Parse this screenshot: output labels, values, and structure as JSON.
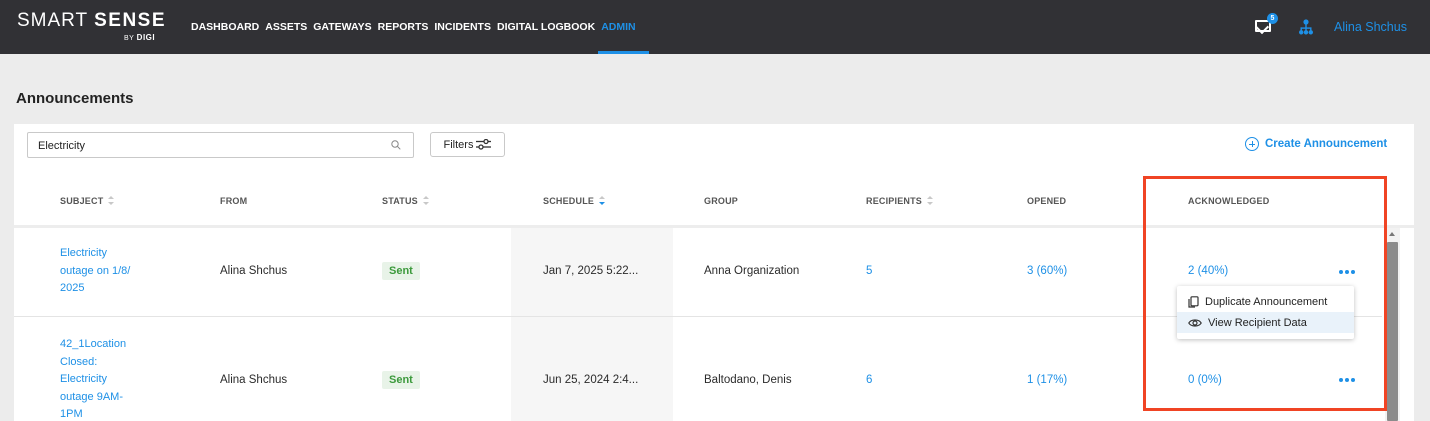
{
  "brand": {
    "name_light": "SMART",
    "name_bold": "SENSE",
    "sub_by": "BY",
    "sub_brand": "DIGI"
  },
  "nav": [
    {
      "label": "DASHBOARD",
      "active": false
    },
    {
      "label": "ASSETS",
      "active": false
    },
    {
      "label": "GATEWAYS",
      "active": false
    },
    {
      "label": "REPORTS",
      "active": false
    },
    {
      "label": "INCIDENTS",
      "active": false
    },
    {
      "label": "DIGITAL LOGBOOK",
      "active": false
    },
    {
      "label": "ADMIN",
      "active": true
    }
  ],
  "header": {
    "mail_badge": "5",
    "user_name": "Alina Shchus"
  },
  "page_title": "Announcements",
  "toolbar": {
    "search_value": "Electricity",
    "filters_label": "Filters",
    "create_label": "Create Announcement"
  },
  "columns": [
    "SUBJECT",
    "FROM",
    "STATUS",
    "SCHEDULE",
    "GROUP",
    "RECIPIENTS",
    "OPENED",
    "ACKNOWLEDGED"
  ],
  "rows": [
    {
      "subject": "Electricity outage on 1/8/ 2025",
      "from": "Alina Shchus",
      "status": "Sent",
      "schedule": "Jan 7, 2025 5:22...",
      "group": "Anna Organization",
      "recipients": "5",
      "opened": "3 (60%)",
      "acknowledged": "2 (40%)"
    },
    {
      "subject": "42_1Location Closed: Electricity outage 9AM- 1PM",
      "from": "Alina Shchus",
      "status": "Sent",
      "schedule": "Jun 25, 2024 2:4...",
      "group": "Baltodano, Denis",
      "recipients": "6",
      "opened": "1 (17%)",
      "acknowledged": "0 (0%)"
    }
  ],
  "context_menu": {
    "items": [
      "Duplicate Announcement",
      "View Recipient Data"
    ]
  },
  "colors": {
    "accent": "#1e90e6",
    "topbar": "#313135",
    "status_sent": "#3c9a3c",
    "highlight": "#f04424"
  }
}
